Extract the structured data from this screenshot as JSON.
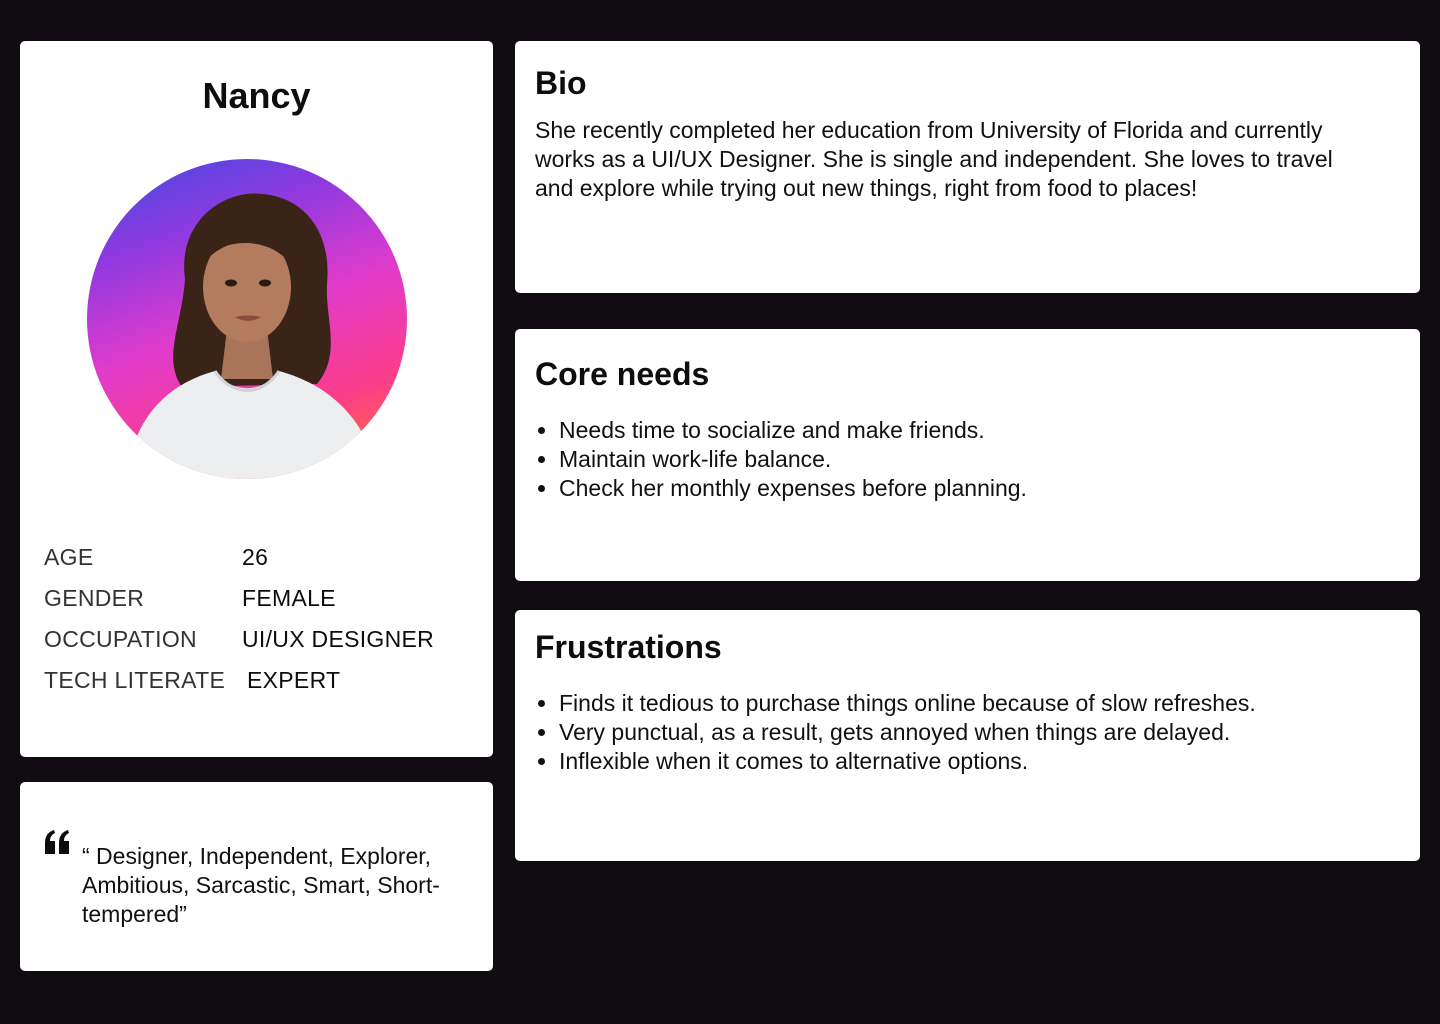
{
  "persona": {
    "name": "Nancy",
    "details": [
      {
        "label": "AGE",
        "value": "26"
      },
      {
        "label": "GENDER",
        "value": "FEMALE"
      },
      {
        "label": "OCCUPATION",
        "value": "UI/UX DESIGNER"
      },
      {
        "label": "TECH LITERATE",
        "value": "EXPERT"
      }
    ],
    "quote": "“ Designer, Independent, Explorer, Ambitious, Sarcastic, Smart, Short-tempered”",
    "avatar_icon": "person-portrait"
  },
  "bio": {
    "title": "Bio",
    "text": "She  recently completed her education from University of Florida and currently works as a UI/UX Designer. She is single and independent. She loves to travel and explore while trying out new things, right from food to places!"
  },
  "core_needs": {
    "title": "Core needs",
    "items": [
      "Needs time to socialize and make friends.",
      "Maintain work-life balance.",
      "Check her monthly expenses before planning."
    ]
  },
  "frustrations": {
    "title": "Frustrations",
    "items": [
      "Finds it tedious to purchase things online because of slow refreshes.",
      "Very punctual, as a result, gets annoyed when things are delayed.",
      "Inflexible when it comes to alternative options."
    ]
  },
  "colors": {
    "background": "#100c12",
    "card": "#ffffff",
    "text": "#111111"
  }
}
